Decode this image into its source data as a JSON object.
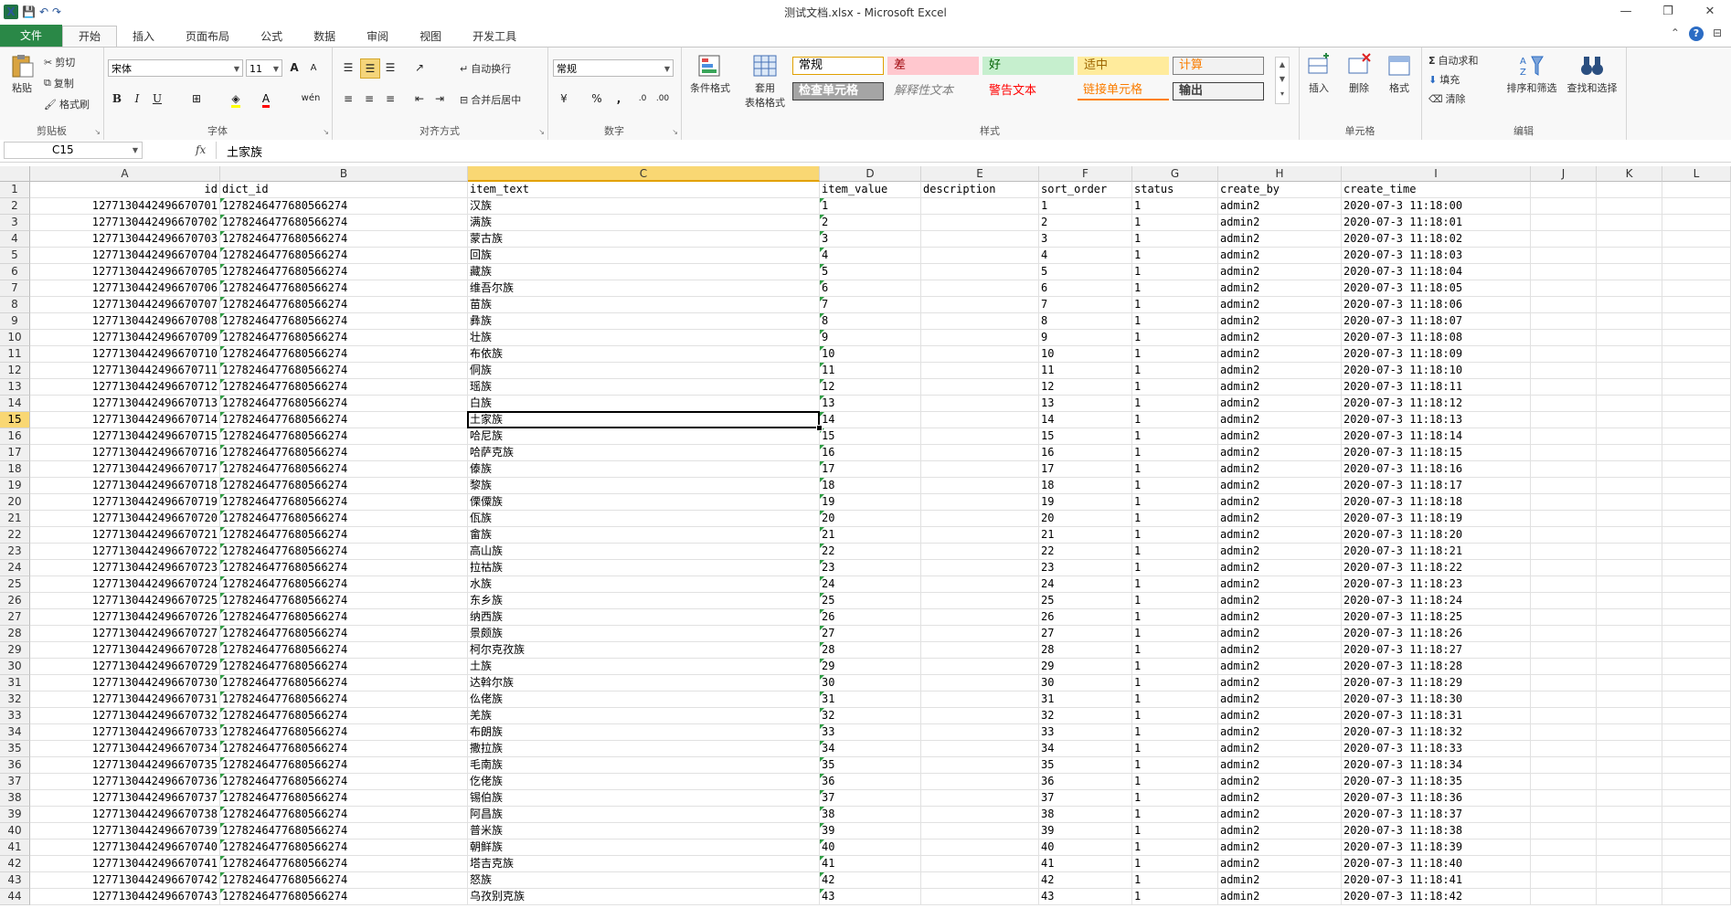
{
  "window": {
    "title": "测试文档.xlsx - Microsoft Excel",
    "controls": [
      "—",
      "❐",
      "✕"
    ]
  },
  "qat": {
    "save": "💾",
    "undo": "↶",
    "redo": "↷"
  },
  "tabs": [
    {
      "label": "文件"
    },
    {
      "label": "开始"
    },
    {
      "label": "插入"
    },
    {
      "label": "页面布局"
    },
    {
      "label": "公式"
    },
    {
      "label": "数据"
    },
    {
      "label": "审阅"
    },
    {
      "label": "视图"
    },
    {
      "label": "开发工具"
    }
  ],
  "ribbon": {
    "clipboard": {
      "label": "剪贴板",
      "paste": "粘贴",
      "cut": "剪切",
      "copy": "复制",
      "format_painter": "格式刷"
    },
    "font": {
      "label": "字体",
      "name": "宋体",
      "size": "11",
      "bold": "B",
      "italic": "I",
      "underline": "U",
      "grow": "A",
      "shrink": "A",
      "font_color": "A",
      "phonetic": "wén"
    },
    "alignment": {
      "label": "对齐方式",
      "wrap": "自动换行",
      "merge": "合并后居中"
    },
    "number": {
      "label": "数字",
      "format": "常规",
      "percent": "%",
      "comma": ",",
      "inc_dec": ".0",
      "dec_dec": ".00"
    },
    "styles": {
      "label": "样式",
      "cond_format": "条件格式",
      "table_format_1": "套用",
      "table_format_2": "表格格式",
      "cells": [
        {
          "label": "常规",
          "bg": "#ffffff",
          "fg": "#000000",
          "border": "#e0a000"
        },
        {
          "label": "差",
          "bg": "#ffc7ce",
          "fg": "#9c0006",
          "border": "#ffc7ce"
        },
        {
          "label": "好",
          "bg": "#c6efce",
          "fg": "#006100",
          "border": "#c6efce"
        },
        {
          "label": "适中",
          "bg": "#ffeb9c",
          "fg": "#9c6500",
          "border": "#ffeb9c"
        },
        {
          "label": "计算",
          "bg": "#f2f2f2",
          "fg": "#fa7d00",
          "border": "#7f7f7f"
        },
        {
          "label": "检查单元格",
          "bg": "#a5a5a5",
          "fg": "#ffffff",
          "border": "#3f3f3f"
        },
        {
          "label": "解释性文本",
          "bg": "#f8f8f8",
          "fg": "#7f7f7f",
          "border": "#f8f8f8"
        },
        {
          "label": "警告文本",
          "bg": "#f8f8f8",
          "fg": "#ff0000",
          "border": "#f8f8f8"
        },
        {
          "label": "链接单元格",
          "bg": "#f8f8f8",
          "fg": "#fa7d00",
          "border": "#ff8001"
        },
        {
          "label": "输出",
          "bg": "#f2f2f2",
          "fg": "#3f3f3f",
          "border": "#3f3f3f"
        }
      ]
    },
    "cells_group": {
      "label": "单元格",
      "insert": "插入",
      "delete": "删除",
      "format": "格式"
    },
    "editing": {
      "label": "编辑",
      "autosum": "自动求和",
      "fill": "填充",
      "clear": "清除",
      "sort_filter": "排序和筛选",
      "find_select": "查找和选择"
    }
  },
  "formula_bar": {
    "name_box": "C15",
    "fx": "fx",
    "content": "土家族"
  },
  "sheet": {
    "columns": [
      "A",
      "B",
      "C",
      "D",
      "E",
      "F",
      "G",
      "H",
      "I",
      "J",
      "K",
      "L"
    ],
    "selected_column": "C",
    "selected_row": 15,
    "header_row": [
      "id",
      "dict_id",
      "item_text",
      "item_value",
      "description",
      "sort_order",
      "status",
      "create_by",
      "create_time"
    ],
    "dict_id": "1278246477680566274",
    "status": "1",
    "create_by": "admin2",
    "rows": [
      {
        "id": "1277130442496670701",
        "text": "汉族",
        "value": "1",
        "time": "2020-07-3 11:18:00"
      },
      {
        "id": "1277130442496670702",
        "text": "满族",
        "value": "2",
        "time": "2020-07-3 11:18:01"
      },
      {
        "id": "1277130442496670703",
        "text": "蒙古族",
        "value": "3",
        "time": "2020-07-3 11:18:02"
      },
      {
        "id": "1277130442496670704",
        "text": "回族",
        "value": "4",
        "time": "2020-07-3 11:18:03"
      },
      {
        "id": "1277130442496670705",
        "text": "藏族",
        "value": "5",
        "time": "2020-07-3 11:18:04"
      },
      {
        "id": "1277130442496670706",
        "text": "维吾尔族",
        "value": "6",
        "time": "2020-07-3 11:18:05"
      },
      {
        "id": "1277130442496670707",
        "text": "苗族",
        "value": "7",
        "time": "2020-07-3 11:18:06"
      },
      {
        "id": "1277130442496670708",
        "text": "彝族",
        "value": "8",
        "time": "2020-07-3 11:18:07"
      },
      {
        "id": "1277130442496670709",
        "text": "壮族",
        "value": "9",
        "time": "2020-07-3 11:18:08"
      },
      {
        "id": "1277130442496670710",
        "text": "布依族",
        "value": "10",
        "time": "2020-07-3 11:18:09"
      },
      {
        "id": "1277130442496670711",
        "text": "侗族",
        "value": "11",
        "time": "2020-07-3 11:18:10"
      },
      {
        "id": "1277130442496670712",
        "text": "瑶族",
        "value": "12",
        "time": "2020-07-3 11:18:11"
      },
      {
        "id": "1277130442496670713",
        "text": "白族",
        "value": "13",
        "time": "2020-07-3 11:18:12"
      },
      {
        "id": "1277130442496670714",
        "text": "土家族",
        "value": "14",
        "time": "2020-07-3 11:18:13"
      },
      {
        "id": "1277130442496670715",
        "text": "哈尼族",
        "value": "15",
        "time": "2020-07-3 11:18:14"
      },
      {
        "id": "1277130442496670716",
        "text": "哈萨克族",
        "value": "16",
        "time": "2020-07-3 11:18:15"
      },
      {
        "id": "1277130442496670717",
        "text": "傣族",
        "value": "17",
        "time": "2020-07-3 11:18:16"
      },
      {
        "id": "1277130442496670718",
        "text": "黎族",
        "value": "18",
        "time": "2020-07-3 11:18:17"
      },
      {
        "id": "1277130442496670719",
        "text": "傈僳族",
        "value": "19",
        "time": "2020-07-3 11:18:18"
      },
      {
        "id": "1277130442496670720",
        "text": "佤族",
        "value": "20",
        "time": "2020-07-3 11:18:19"
      },
      {
        "id": "1277130442496670721",
        "text": "畲族",
        "value": "21",
        "time": "2020-07-3 11:18:20"
      },
      {
        "id": "1277130442496670722",
        "text": "高山族",
        "value": "22",
        "time": "2020-07-3 11:18:21"
      },
      {
        "id": "1277130442496670723",
        "text": "拉祜族",
        "value": "23",
        "time": "2020-07-3 11:18:22"
      },
      {
        "id": "1277130442496670724",
        "text": "水族",
        "value": "24",
        "time": "2020-07-3 11:18:23"
      },
      {
        "id": "1277130442496670725",
        "text": "东乡族",
        "value": "25",
        "time": "2020-07-3 11:18:24"
      },
      {
        "id": "1277130442496670726",
        "text": "纳西族",
        "value": "26",
        "time": "2020-07-3 11:18:25"
      },
      {
        "id": "1277130442496670727",
        "text": "景颇族",
        "value": "27",
        "time": "2020-07-3 11:18:26"
      },
      {
        "id": "1277130442496670728",
        "text": "柯尔克孜族",
        "value": "28",
        "time": "2020-07-3 11:18:27"
      },
      {
        "id": "1277130442496670729",
        "text": "土族",
        "value": "29",
        "time": "2020-07-3 11:18:28"
      },
      {
        "id": "1277130442496670730",
        "text": "达斡尔族",
        "value": "30",
        "time": "2020-07-3 11:18:29"
      },
      {
        "id": "1277130442496670731",
        "text": "仫佬族",
        "value": "31",
        "time": "2020-07-3 11:18:30"
      },
      {
        "id": "1277130442496670732",
        "text": "羌族",
        "value": "32",
        "time": "2020-07-3 11:18:31"
      },
      {
        "id": "1277130442496670733",
        "text": "布朗族",
        "value": "33",
        "time": "2020-07-3 11:18:32"
      },
      {
        "id": "1277130442496670734",
        "text": "撒拉族",
        "value": "34",
        "time": "2020-07-3 11:18:33"
      },
      {
        "id": "1277130442496670735",
        "text": "毛南族",
        "value": "35",
        "time": "2020-07-3 11:18:34"
      },
      {
        "id": "1277130442496670736",
        "text": "仡佬族",
        "value": "36",
        "time": "2020-07-3 11:18:35"
      },
      {
        "id": "1277130442496670737",
        "text": "锡伯族",
        "value": "37",
        "time": "2020-07-3 11:18:36"
      },
      {
        "id": "1277130442496670738",
        "text": "阿昌族",
        "value": "38",
        "time": "2020-07-3 11:18:37"
      },
      {
        "id": "1277130442496670739",
        "text": "普米族",
        "value": "39",
        "time": "2020-07-3 11:18:38"
      },
      {
        "id": "1277130442496670740",
        "text": "朝鲜族",
        "value": "40",
        "time": "2020-07-3 11:18:39"
      },
      {
        "id": "1277130442496670741",
        "text": "塔吉克族",
        "value": "41",
        "time": "2020-07-3 11:18:40"
      },
      {
        "id": "1277130442496670742",
        "text": "怒族",
        "value": "42",
        "time": "2020-07-3 11:18:41"
      },
      {
        "id": "1277130442496670743",
        "text": "乌孜别克族",
        "value": "43",
        "time": "2020-07-3 11:18:42"
      }
    ]
  }
}
